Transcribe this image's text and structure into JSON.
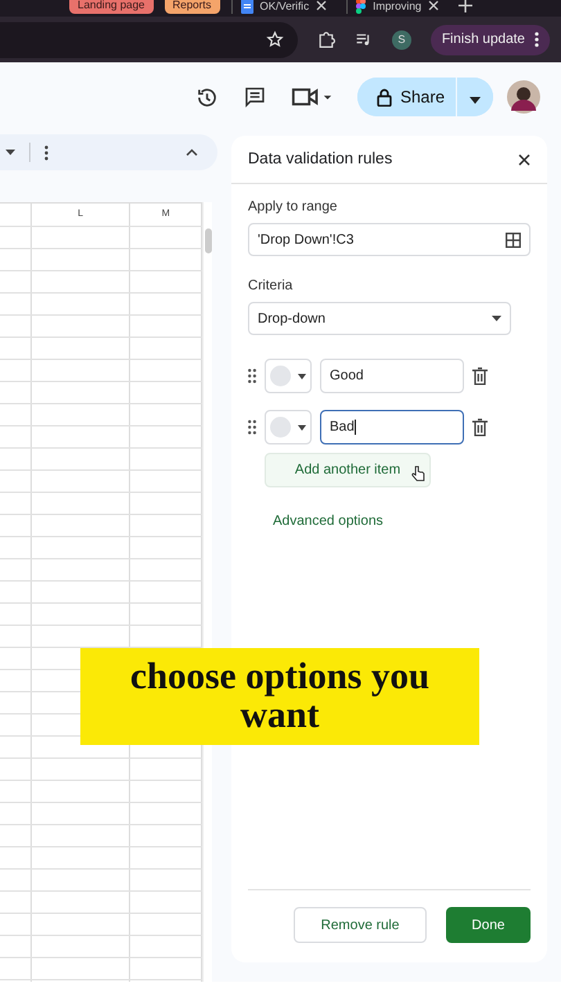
{
  "browser": {
    "tab_groups": [
      {
        "label": "Landing page",
        "color": "#e8716b"
      },
      {
        "label": "Reports",
        "color": "#f4a46a"
      }
    ],
    "tabs": [
      {
        "title": "OK/Verific",
        "kind": "document"
      },
      {
        "title": "Improving",
        "kind": "design"
      }
    ],
    "profile_initial": "S",
    "update_button": "Finish update"
  },
  "header": {
    "share_button": "Share"
  },
  "sheet": {
    "columns": [
      "L",
      "M"
    ]
  },
  "panel": {
    "title": "Data validation rules",
    "range_label": "Apply to range",
    "range_value": "'Drop Down'!C3",
    "criteria_label": "Criteria",
    "criteria_value": "Drop-down",
    "items": [
      {
        "value": "Good",
        "focused": false
      },
      {
        "value": "Bad",
        "focused": true
      }
    ],
    "add_button": "Add another item",
    "advanced_link": "Advanced options",
    "remove_button": "Remove rule",
    "done_button": "Done"
  },
  "caption": "choose options you want"
}
